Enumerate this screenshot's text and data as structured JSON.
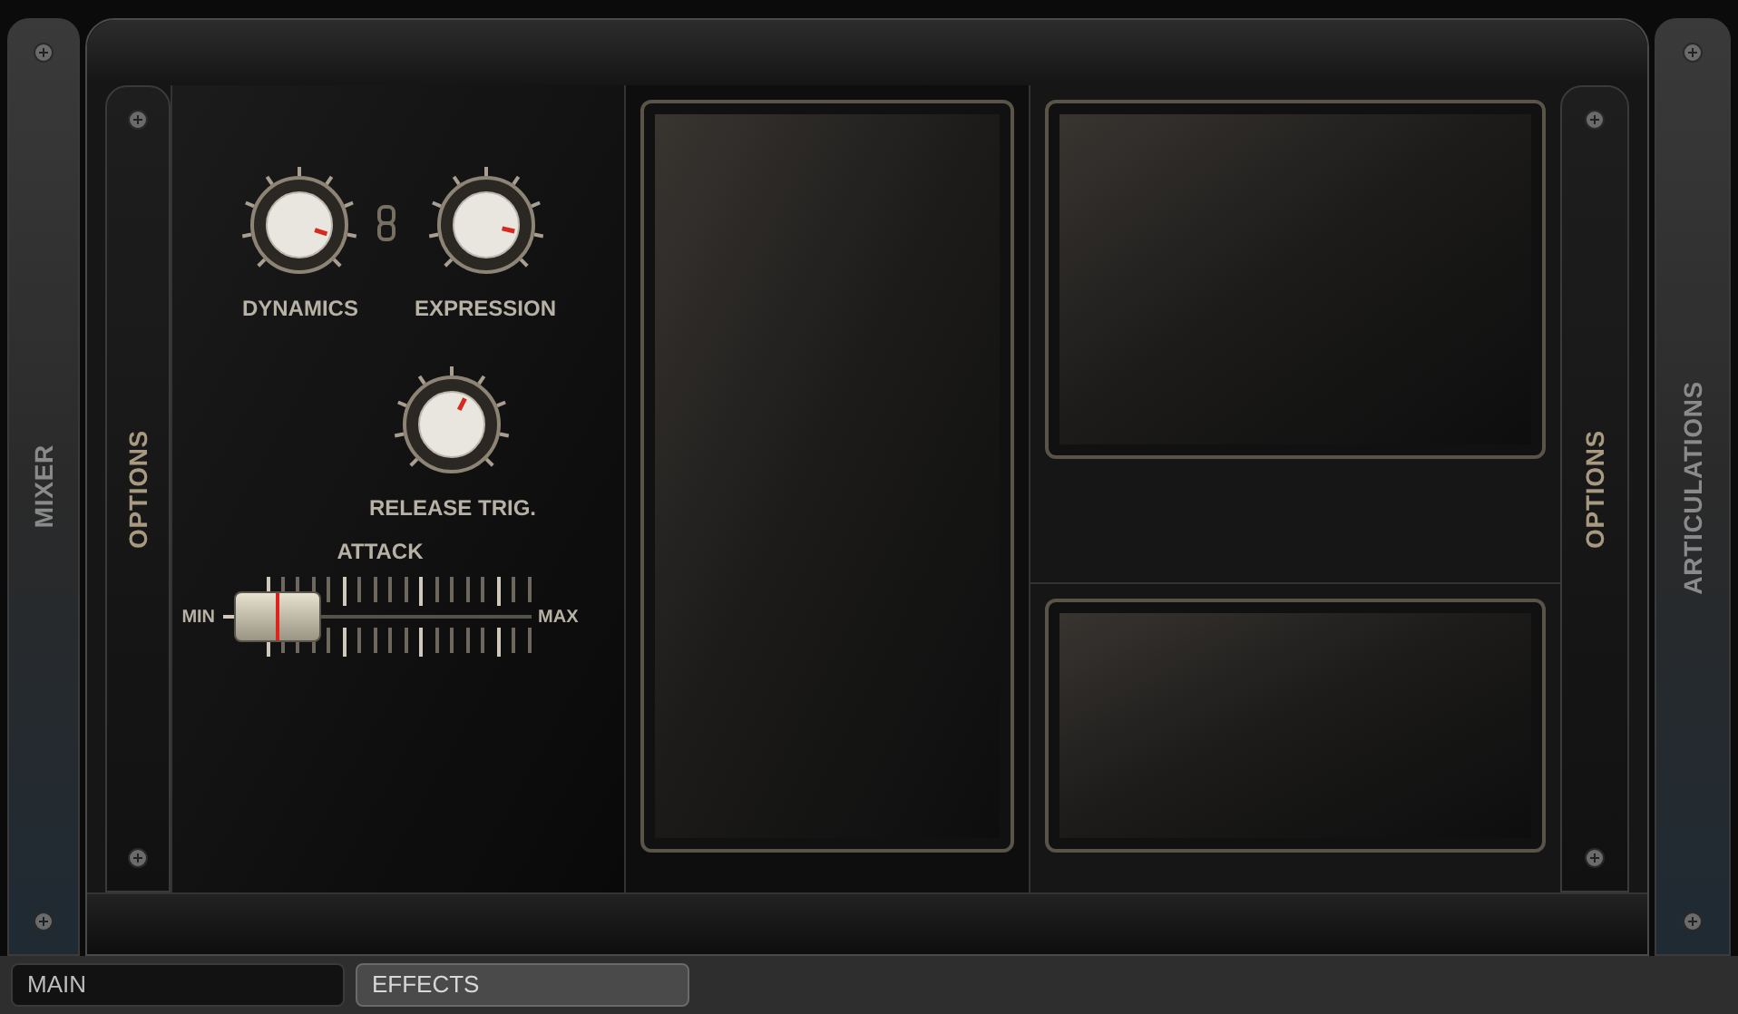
{
  "side_tabs": {
    "left": [
      "MIXER",
      "OPTIONS"
    ],
    "right": [
      "OPTIONS",
      "ARTICULATIONS"
    ]
  },
  "knobs": [
    {
      "label": "DYNAMICS",
      "level": 0.9
    },
    {
      "label": "EXPRESSION",
      "level": 0.88
    },
    {
      "label": "RELEASE TRIG.",
      "level": 0.6
    }
  ],
  "knobs_linked": true,
  "attack": {
    "label": "ATTACK",
    "min_label": "MIN",
    "max_label": "MAX",
    "level": 0.05
  },
  "bottom_tabs": [
    {
      "label": "MAIN",
      "selected": true
    },
    {
      "label": "EFFECTS",
      "selected": false
    }
  ]
}
